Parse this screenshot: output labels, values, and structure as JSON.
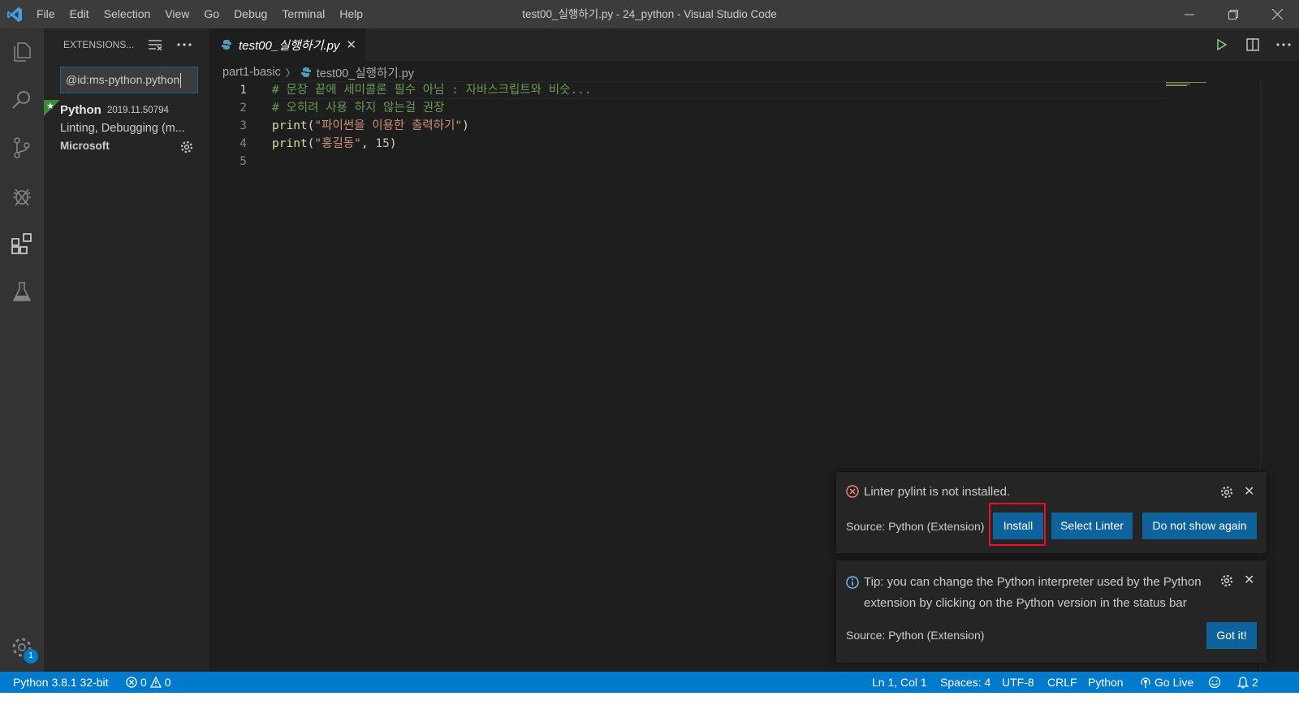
{
  "app": {
    "window_title": "test00_실행하기.py - 24_python - Visual Studio Code",
    "menu": [
      "File",
      "Edit",
      "Selection",
      "View",
      "Go",
      "Debug",
      "Terminal",
      "Help"
    ]
  },
  "activity_bar": {
    "items": [
      "files-icon",
      "search-icon",
      "source-control-icon",
      "debug-icon",
      "extensions-icon",
      "test-flask-icon"
    ],
    "manage_badge": "1"
  },
  "sidebar": {
    "header": "EXTENSIONS...",
    "search_value": "@id:ms-python.python",
    "extension": {
      "name": "Python",
      "version": "2019.11.50794",
      "description": "Linting, Debugging (m...",
      "publisher": "Microsoft"
    }
  },
  "editor": {
    "tab_label": "test00_실행하기.py",
    "breadcrumb": [
      "part1-basic",
      "test00_실행하기.py"
    ],
    "lines": [
      {
        "n": "1",
        "tokens": [
          {
            "t": "# 문장 끝에 세미콜론 필수 아님 : 자바스크립트와 비슷...",
            "c": "c-comment"
          }
        ]
      },
      {
        "n": "2",
        "tokens": [
          {
            "t": "# 오히려 사용 하지 않는걸 권장",
            "c": "c-comment"
          }
        ]
      },
      {
        "n": "3",
        "tokens": [
          {
            "t": "print",
            "c": "c-fn"
          },
          {
            "t": "(",
            "c": "c-plain"
          },
          {
            "t": "\"파이썬을 이용한 출력하기\"",
            "c": "c-str"
          },
          {
            "t": ")",
            "c": "c-plain"
          }
        ]
      },
      {
        "n": "4",
        "tokens": [
          {
            "t": "print",
            "c": "c-fn"
          },
          {
            "t": "(",
            "c": "c-plain"
          },
          {
            "t": "\"홍길동\"",
            "c": "c-str"
          },
          {
            "t": ", ",
            "c": "c-plain"
          },
          {
            "t": "15",
            "c": "c-num"
          },
          {
            "t": ")",
            "c": "c-plain"
          }
        ]
      },
      {
        "n": "5",
        "tokens": []
      }
    ]
  },
  "notifications": {
    "linter": {
      "message": "Linter pylint is not installed.",
      "source": "Source: Python (Extension)",
      "buttons": {
        "install": "Install",
        "select": "Select Linter",
        "dismiss": "Do not show again"
      }
    },
    "tip": {
      "line1": "Tip: you can change the Python interpreter used by the Python",
      "line2": "extension by clicking on the Python version in the status bar",
      "source": "Source: Python (Extension)",
      "button": "Got it!"
    }
  },
  "status_bar": {
    "interpreter": "Python 3.8.1 32-bit",
    "errors": "0",
    "warnings": "0",
    "position": "Ln 1, Col 1",
    "spaces": "Spaces: 4",
    "encoding": "UTF-8",
    "eol": "CRLF",
    "language": "Python",
    "go_live": "Go Live",
    "notifications_count": "2"
  },
  "colors": {
    "accent": "#007acc",
    "button": "#0e639c",
    "error": "#f48771",
    "info": "#75beff",
    "highlight_box": "#e81123"
  }
}
